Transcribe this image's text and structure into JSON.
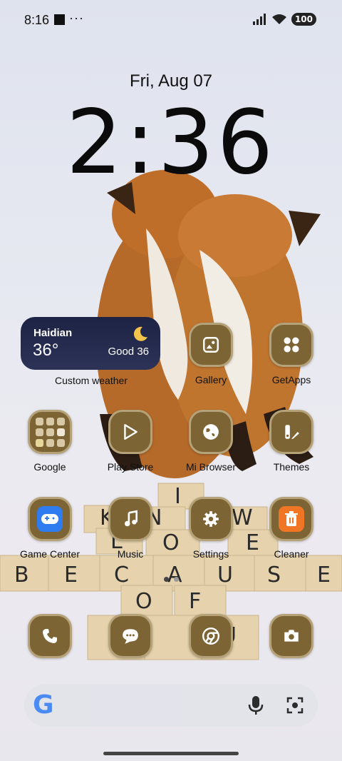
{
  "status": {
    "time": "8:16",
    "battery": "100"
  },
  "lock": {
    "date": "Fri, Aug 07",
    "clock": "2:36"
  },
  "weather": {
    "city": "Haidian",
    "temp": "36°",
    "aqi": "Good 36",
    "label": "Custom weather"
  },
  "apps_row1": [
    {
      "label": "Gallery"
    },
    {
      "label": "GetApps"
    }
  ],
  "apps_row2": [
    {
      "label": "Google"
    },
    {
      "label": "Play Store"
    },
    {
      "label": "Mi Browser"
    },
    {
      "label": "Themes"
    }
  ],
  "apps_row3": [
    {
      "label": "Game Center"
    },
    {
      "label": "Music"
    },
    {
      "label": "Settings"
    },
    {
      "label": "Cleaner"
    }
  ],
  "dock": [
    {
      "icon": "phone-icon"
    },
    {
      "icon": "messages-icon"
    },
    {
      "icon": "chrome-icon"
    },
    {
      "icon": "camera-icon"
    }
  ],
  "search": {
    "logo": "G"
  },
  "colors": {
    "icon_bg": "#7d6435",
    "icon_border": "#b6a278",
    "weather_bg": "#1d2344"
  }
}
